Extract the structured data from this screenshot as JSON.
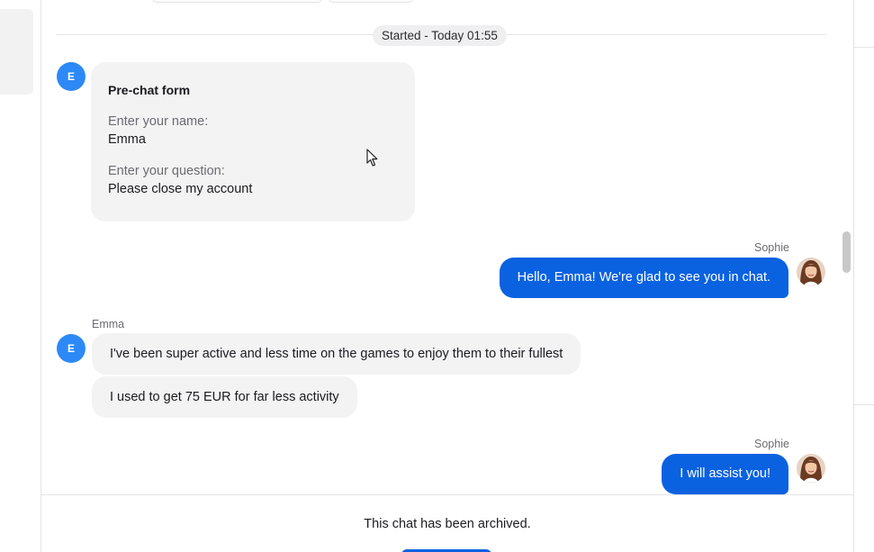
{
  "separator": {
    "label": "Started - Today 01:55"
  },
  "customer": {
    "initial": "E",
    "name": "Emma"
  },
  "agent": {
    "name": "Sophie"
  },
  "prechat_form": {
    "title": "Pre-chat form",
    "fields": [
      {
        "label": "Enter your name:",
        "value": "Emma"
      },
      {
        "label": "Enter your question:",
        "value": "Please close my account"
      }
    ]
  },
  "messages": [
    {
      "sender": "Sophie",
      "direction": "out",
      "text": "Hello, Emma! We're glad to see you in chat."
    },
    {
      "sender": "Emma",
      "direction": "in",
      "text": "I've been super active and less time on the games to enjoy them to their fullest"
    },
    {
      "sender": "Emma",
      "direction": "in",
      "text": "I used to get 75 EUR for far less activity"
    },
    {
      "sender": "Sophie",
      "direction": "out",
      "text": "I will assist you!"
    }
  ],
  "footer": {
    "archived_text": "This chat has been archived."
  },
  "colors": {
    "agent_bubble": "#0a62e0",
    "customer_avatar": "#2d89f5",
    "customer_bubble": "#f3f3f4"
  }
}
